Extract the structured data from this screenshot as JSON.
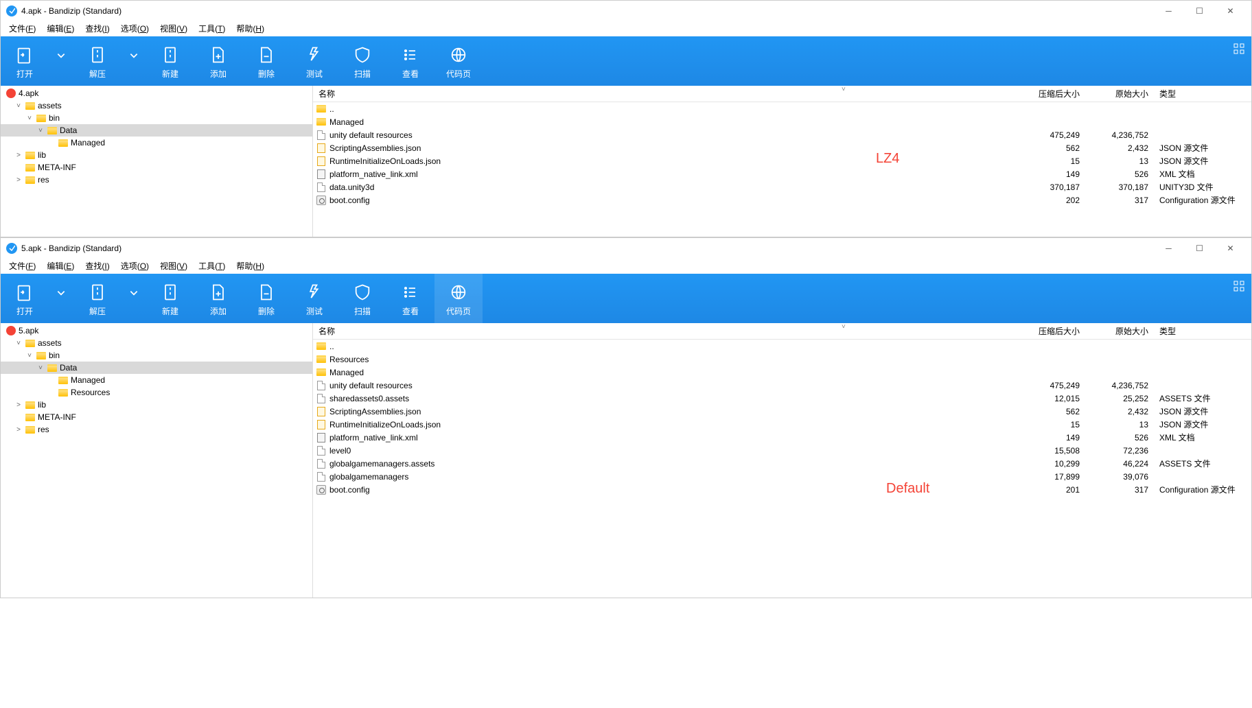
{
  "windows": [
    {
      "title": "4.apk - Bandizip (Standard)",
      "annotation": "LZ4",
      "tree": {
        "root": "4.apk",
        "nodes": [
          {
            "indent": 0,
            "twist": "˅",
            "label": "assets"
          },
          {
            "indent": 1,
            "twist": "˅",
            "label": "bin"
          },
          {
            "indent": 2,
            "twist": "˅",
            "label": "Data",
            "selected": true
          },
          {
            "indent": 3,
            "twist": "",
            "label": "Managed"
          },
          {
            "indent": 0,
            "twist": "˃",
            "label": "lib"
          },
          {
            "indent": 0,
            "twist": "",
            "label": "META-INF"
          },
          {
            "indent": 0,
            "twist": "˃",
            "label": "res"
          }
        ]
      },
      "files": [
        {
          "icon": "folder",
          "name": "..",
          "comp": "",
          "orig": "",
          "type": ""
        },
        {
          "icon": "folder",
          "name": "Managed",
          "comp": "",
          "orig": "",
          "type": ""
        },
        {
          "icon": "file",
          "name": "unity default resources",
          "comp": "475,249",
          "orig": "4,236,752",
          "type": ""
        },
        {
          "icon": "json",
          "name": "ScriptingAssemblies.json",
          "comp": "562",
          "orig": "2,432",
          "type": "JSON 源文件"
        },
        {
          "icon": "json",
          "name": "RuntimeInitializeOnLoads.json",
          "comp": "15",
          "orig": "13",
          "type": "JSON 源文件"
        },
        {
          "icon": "xml",
          "name": "platform_native_link.xml",
          "comp": "149",
          "orig": "526",
          "type": "XML 文档"
        },
        {
          "icon": "file",
          "name": "data.unity3d",
          "comp": "370,187",
          "orig": "370,187",
          "type": "UNITY3D 文件"
        },
        {
          "icon": "cfg",
          "name": "boot.config",
          "comp": "202",
          "orig": "317",
          "type": "Configuration 源文件"
        }
      ]
    },
    {
      "title": "5.apk - Bandizip (Standard)",
      "annotation": "Default",
      "highlight_codepage": true,
      "tree": {
        "root": "5.apk",
        "nodes": [
          {
            "indent": 0,
            "twist": "˅",
            "label": "assets"
          },
          {
            "indent": 1,
            "twist": "˅",
            "label": "bin"
          },
          {
            "indent": 2,
            "twist": "˅",
            "label": "Data",
            "selected": true
          },
          {
            "indent": 3,
            "twist": "",
            "label": "Managed"
          },
          {
            "indent": 3,
            "twist": "",
            "label": "Resources"
          },
          {
            "indent": 0,
            "twist": "˃",
            "label": "lib"
          },
          {
            "indent": 0,
            "twist": "",
            "label": "META-INF"
          },
          {
            "indent": 0,
            "twist": "˃",
            "label": "res"
          }
        ]
      },
      "files": [
        {
          "icon": "folder",
          "name": "..",
          "comp": "",
          "orig": "",
          "type": ""
        },
        {
          "icon": "folder",
          "name": "Resources",
          "comp": "",
          "orig": "",
          "type": ""
        },
        {
          "icon": "folder",
          "name": "Managed",
          "comp": "",
          "orig": "",
          "type": ""
        },
        {
          "icon": "file",
          "name": "unity default resources",
          "comp": "475,249",
          "orig": "4,236,752",
          "type": ""
        },
        {
          "icon": "file",
          "name": "sharedassets0.assets",
          "comp": "12,015",
          "orig": "25,252",
          "type": "ASSETS 文件"
        },
        {
          "icon": "json",
          "name": "ScriptingAssemblies.json",
          "comp": "562",
          "orig": "2,432",
          "type": "JSON 源文件"
        },
        {
          "icon": "json",
          "name": "RuntimeInitializeOnLoads.json",
          "comp": "15",
          "orig": "13",
          "type": "JSON 源文件"
        },
        {
          "icon": "xml",
          "name": "platform_native_link.xml",
          "comp": "149",
          "orig": "526",
          "type": "XML 文档"
        },
        {
          "icon": "file",
          "name": "level0",
          "comp": "15,508",
          "orig": "72,236",
          "type": ""
        },
        {
          "icon": "file",
          "name": "globalgamemanagers.assets",
          "comp": "10,299",
          "orig": "46,224",
          "type": "ASSETS 文件"
        },
        {
          "icon": "file",
          "name": "globalgamemanagers",
          "comp": "17,899",
          "orig": "39,076",
          "type": ""
        },
        {
          "icon": "cfg",
          "name": "boot.config",
          "comp": "201",
          "orig": "317",
          "type": "Configuration 源文件"
        }
      ]
    }
  ],
  "menu": [
    {
      "label": "文件(F)",
      "key": "F"
    },
    {
      "label": "编辑(E)",
      "key": "E"
    },
    {
      "label": "查找(I)",
      "key": "I"
    },
    {
      "label": "选项(O)",
      "key": "O"
    },
    {
      "label": "视图(V)",
      "key": "V"
    },
    {
      "label": "工具(T)",
      "key": "T"
    },
    {
      "label": "帮助(H)",
      "key": "H"
    }
  ],
  "toolbar": [
    {
      "id": "open",
      "label": "打开",
      "dd": true
    },
    {
      "id": "extract",
      "label": "解压",
      "dd": true
    },
    {
      "id": "new",
      "label": "新建"
    },
    {
      "id": "add",
      "label": "添加"
    },
    {
      "id": "delete",
      "label": "删除"
    },
    {
      "id": "test",
      "label": "测试"
    },
    {
      "id": "scan",
      "label": "扫描"
    },
    {
      "id": "view",
      "label": "查看"
    },
    {
      "id": "codepage",
      "label": "代码页"
    }
  ],
  "columns": {
    "name": "名称",
    "comp": "压缩后大小",
    "orig": "原始大小",
    "type": "类型"
  }
}
